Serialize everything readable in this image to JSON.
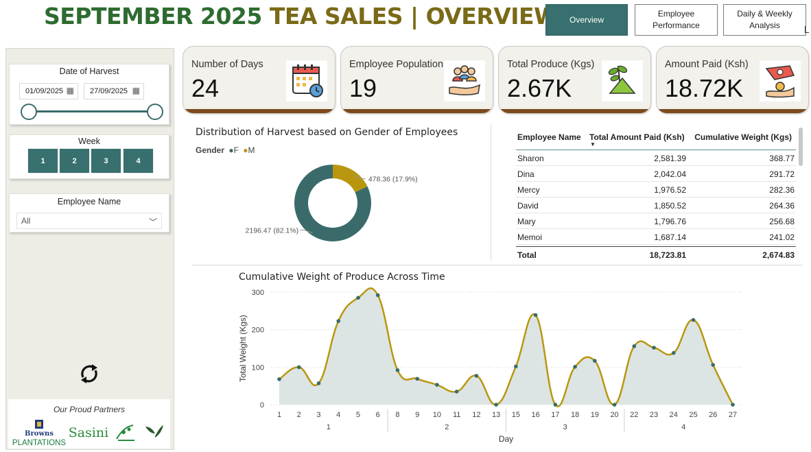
{
  "title": {
    "part1": "SEPTEMBER 2025 ",
    "part2": "TEA SALES | OVERVIEW"
  },
  "nav": {
    "overview": "Overview",
    "employee_performance_line1": "Employee",
    "employee_performance_line2": "Performance",
    "daily_weekly_line1": "Daily & Weekly",
    "daily_weekly_line2": "Analysis"
  },
  "date_slicer": {
    "title": "Date of Harvest",
    "start": "01/09/2025",
    "end": "27/09/2025"
  },
  "week_slicer": {
    "title": "Week",
    "weeks": [
      "1",
      "2",
      "3",
      "4"
    ]
  },
  "employee_slicer": {
    "title": "Employee Name",
    "value": "All"
  },
  "partners": {
    "label": "Our Proud Partners",
    "browns_line1": "Browns",
    "browns_line2": "PLANTATIONS",
    "sasini": "Sasini"
  },
  "kpis": [
    {
      "label": "Number of Days",
      "value": "24",
      "icon": "calendar-icon"
    },
    {
      "label": "Employee Population",
      "value": "19",
      "icon": "people-icon"
    },
    {
      "label": "Total Produce (Kgs)",
      "value": "2.67K",
      "icon": "tea-plant-icon"
    },
    {
      "label": "Amount Paid (Ksh)",
      "value": "18.72K",
      "icon": "payment-icon"
    }
  ],
  "donut": {
    "title": "Distribution of Harvest based on Gender of Employees",
    "legend_title": "Gender",
    "legend": [
      {
        "name": "F",
        "color": "#3a6b6a"
      },
      {
        "name": "M",
        "color": "#b8970f"
      }
    ],
    "label_f": "2196.47 (82.1%)",
    "label_m": "478.36 (17.9%)"
  },
  "table": {
    "headers": [
      "Employee Name",
      "Total Amount Paid (Ksh)",
      "Cumulative Weight (Kgs)"
    ],
    "rows": [
      [
        "Sharon",
        "2,581.39",
        "368.77"
      ],
      [
        "Dina",
        "2,042.04",
        "291.72"
      ],
      [
        "Mercy",
        "1,976.52",
        "282.36"
      ],
      [
        "David",
        "1,850.52",
        "264.36"
      ],
      [
        "Mary",
        "1,796.76",
        "256.68"
      ],
      [
        "Memoi",
        "1,687.14",
        "241.02"
      ]
    ],
    "total": [
      "Total",
      "18,723.81",
      "2,674.83"
    ]
  },
  "line_chart": {
    "title": "Cumulative Weight of Produce Across Time",
    "xlabel": "Day",
    "ylabel": "Total Weight (Kgs)",
    "week_labels": [
      "1",
      "2",
      "3",
      "4"
    ]
  },
  "colors": {
    "accent": "#37706e",
    "line": "#b8970f",
    "area": "#dde4e4",
    "point": "#3a6b6a",
    "kpi_bar": "#7b4a1e",
    "title_green": "#2e6b30",
    "title_olive": "#7a6a17"
  },
  "chart_data": [
    {
      "type": "pie",
      "title": "Distribution of Harvest based on Gender of Employees",
      "categories": [
        "F",
        "M"
      ],
      "values": [
        2196.47,
        478.36
      ]
    },
    {
      "type": "area",
      "title": "Cumulative Weight of Produce Across Time",
      "xlabel": "Day",
      "ylabel": "Total Weight (Kgs)",
      "x": [
        1,
        2,
        3,
        4,
        5,
        6,
        8,
        9,
        10,
        11,
        12,
        13,
        15,
        16,
        17,
        18,
        19,
        20,
        22,
        23,
        24,
        25,
        26,
        27
      ],
      "values": [
        68,
        100,
        57,
        223,
        285,
        292,
        92,
        69,
        53,
        35,
        77,
        0,
        102,
        239,
        0,
        101,
        117,
        0,
        156,
        152,
        138,
        226,
        106,
        0
      ],
      "week_groups": [
        {
          "week": "1",
          "days": [
            1,
            6
          ]
        },
        {
          "week": "2",
          "days": [
            8,
            13
          ]
        },
        {
          "week": "3",
          "days": [
            15,
            20
          ]
        },
        {
          "week": "4",
          "days": [
            22,
            27
          ]
        }
      ],
      "ylim": [
        0,
        300
      ],
      "yticks": [
        0,
        100,
        200,
        300
      ],
      "grid": true
    }
  ]
}
